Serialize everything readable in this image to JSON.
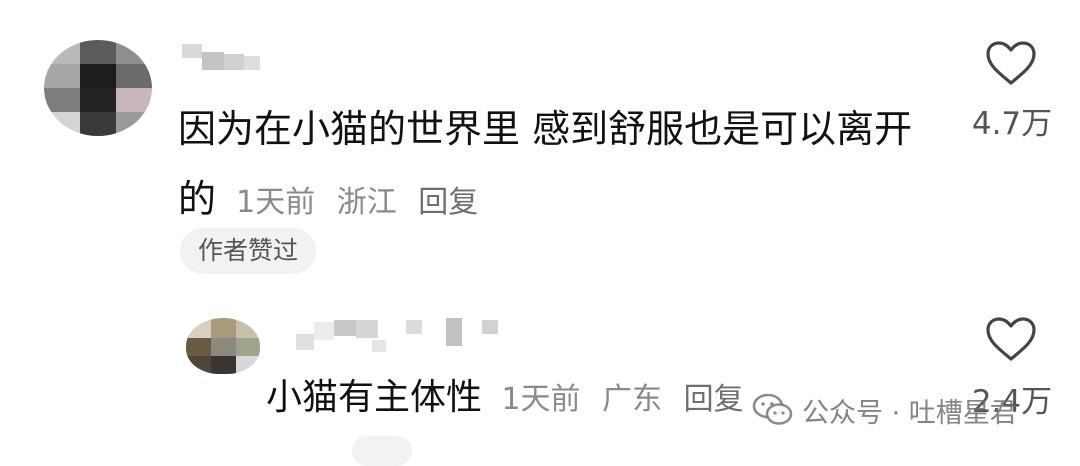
{
  "comment": {
    "text": "因为在小猫的世界里 感到舒服也是可以离开的",
    "time": "1天前",
    "location": "浙江",
    "reply_label": "回复",
    "author_liked_badge": "作者赞过",
    "like_count": "4.7万"
  },
  "reply": {
    "text": "小猫有主体性",
    "time": "1天前",
    "location": "广东",
    "reply_label": "回复",
    "like_count": "2.4万"
  },
  "watermark": {
    "text": "公众号 · 吐槽星君"
  },
  "colors": {
    "text_primary": "#111111",
    "text_meta": "#8a8a8a",
    "badge_bg": "#f2f2f2",
    "icon": "#444444"
  }
}
